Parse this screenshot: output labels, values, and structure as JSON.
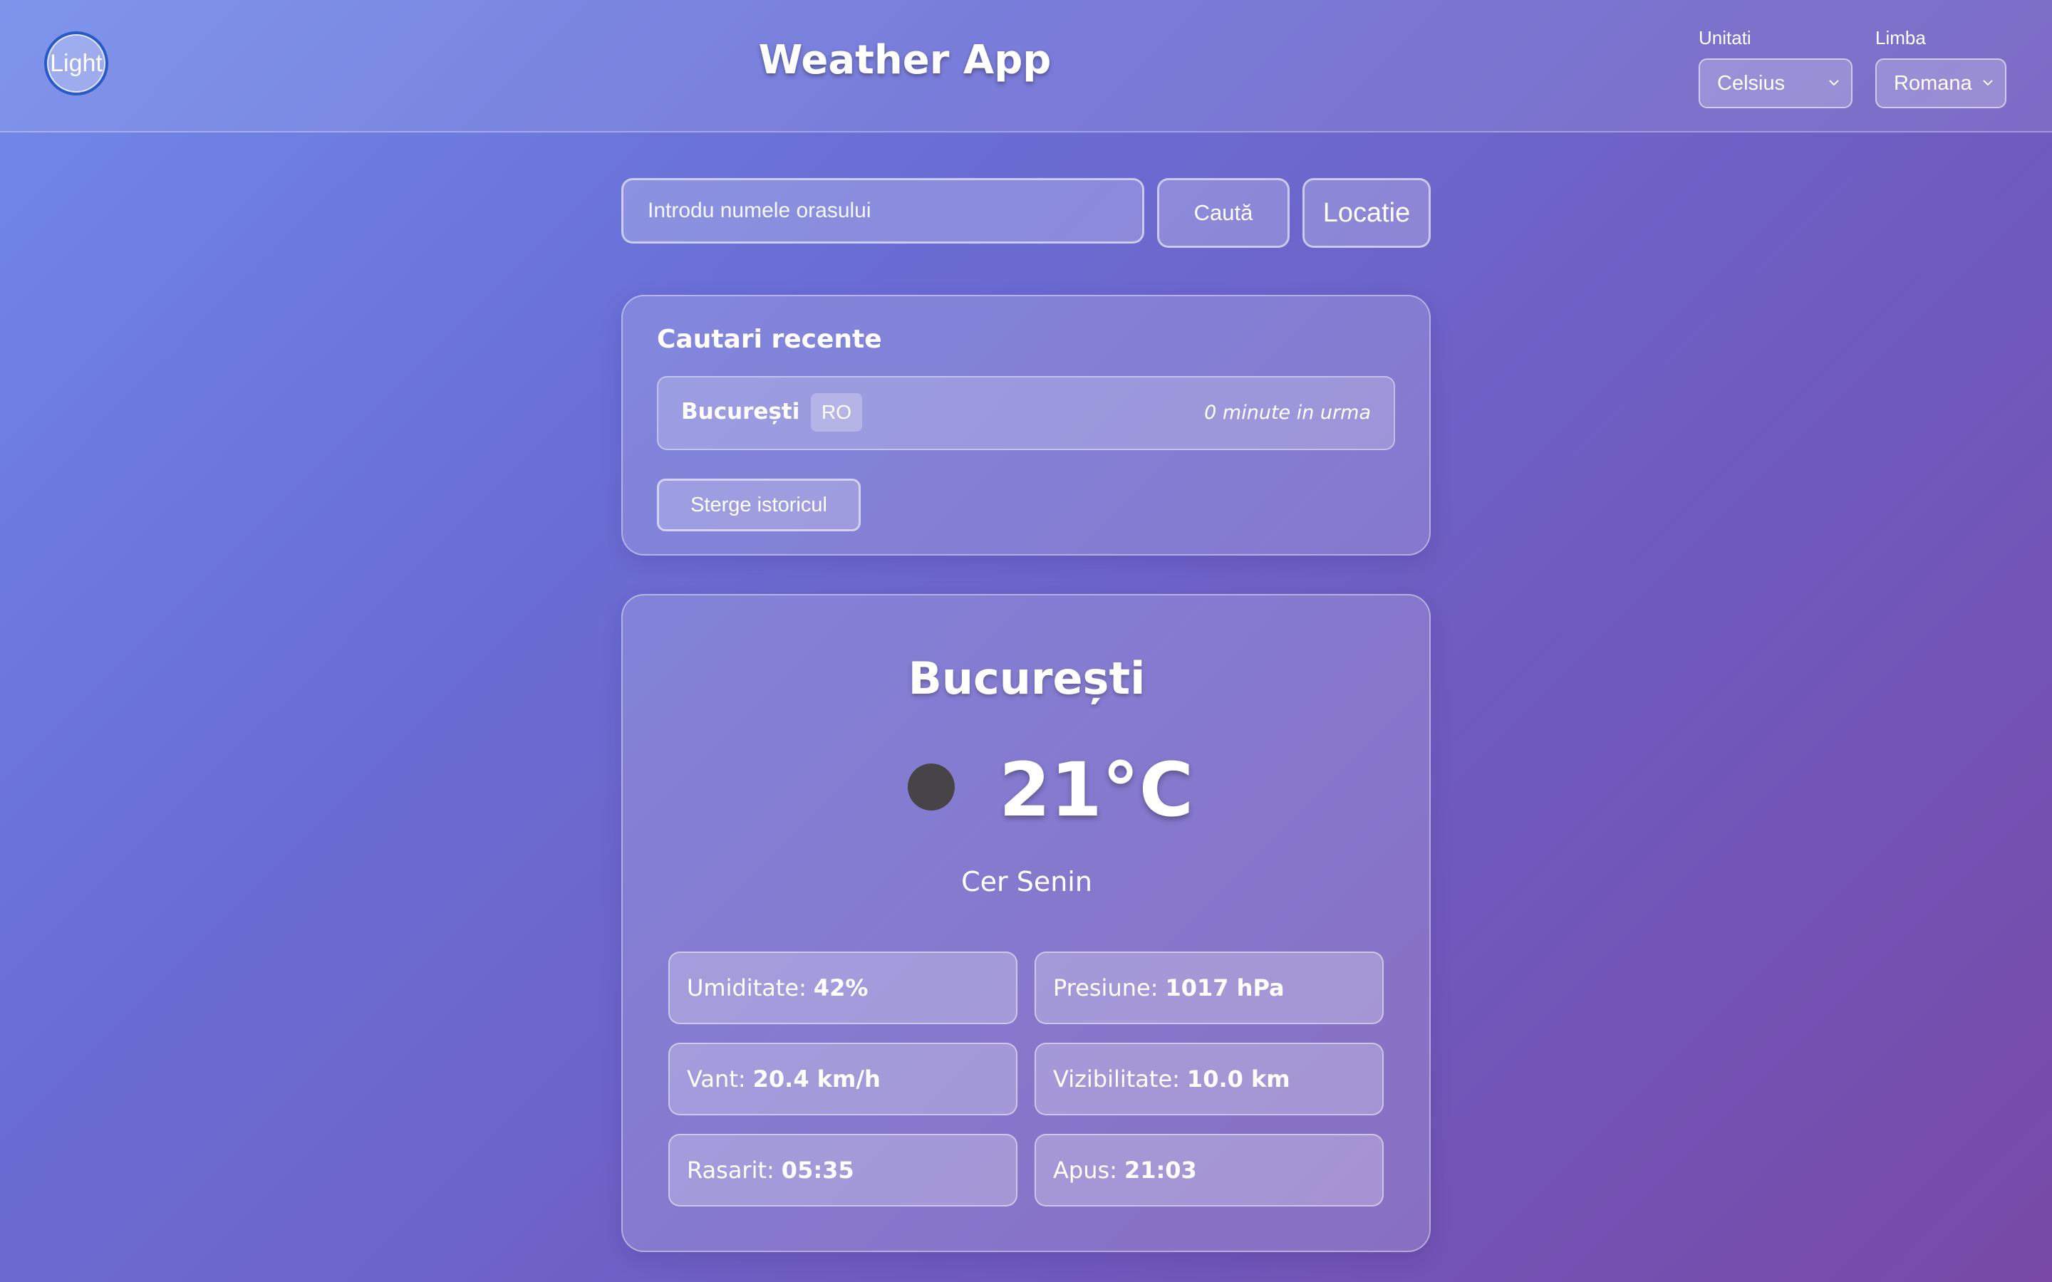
{
  "header": {
    "theme_toggle_label": "Light",
    "title": "Weather App",
    "units": {
      "label": "Unitati",
      "selected": "Celsius"
    },
    "language": {
      "label": "Limba",
      "selected": "Romana"
    }
  },
  "search": {
    "placeholder": "Introdu numele orasului",
    "search_button": "Caută",
    "location_button": "Locatie"
  },
  "recent": {
    "title": "Cautari recente",
    "items": [
      {
        "city": "București",
        "country": "RO",
        "time": "0 minute in urma"
      }
    ],
    "clear_button": "Sterge istoricul"
  },
  "weather": {
    "city": "București",
    "icon": "weather-icon",
    "temperature": "21°C",
    "description": "Cer Senin",
    "details": {
      "humidity": {
        "label": "Umiditate:",
        "value": "42%"
      },
      "pressure": {
        "label": "Presiune:",
        "value": "1017 hPa"
      },
      "wind": {
        "label": "Vant:",
        "value": "20.4 km/h"
      },
      "visibility": {
        "label": "Vizibilitate:",
        "value": "10.0 km"
      },
      "sunrise": {
        "label": "Rasarit:",
        "value": "05:35"
      },
      "sunset": {
        "label": "Apus:",
        "value": "21:03"
      }
    }
  },
  "colors": {
    "background_start": "#7189ea",
    "background_end": "#7849a6",
    "toggle_border": "#2a59c8",
    "weather_icon": "#474448"
  }
}
